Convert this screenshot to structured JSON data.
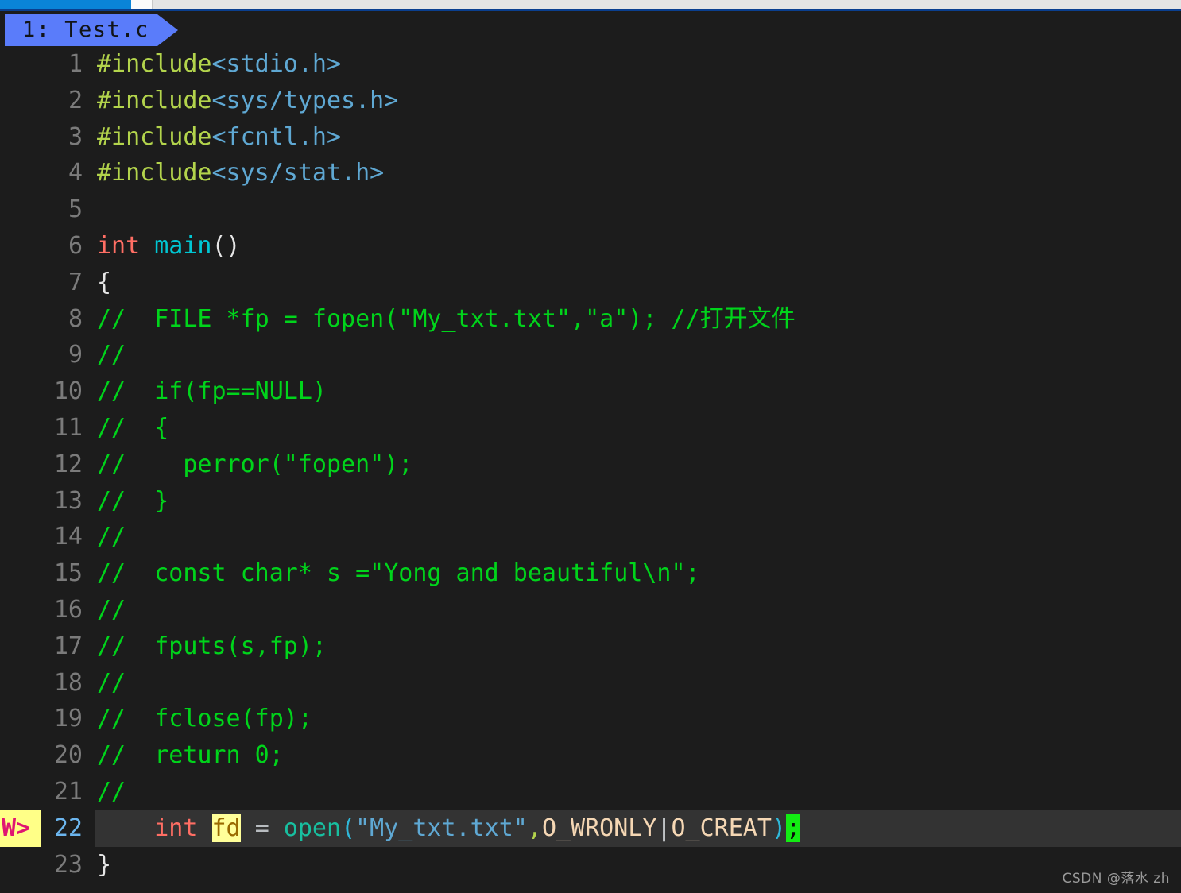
{
  "window": {
    "os_bar": {
      "active_segment_label": "",
      "accent_color": "#0a84d8",
      "underline_color": "#0a3f8f"
    }
  },
  "editor": {
    "app": "vim",
    "background_color": "#1c1c1c",
    "tabline": {
      "tabs": [
        {
          "label": "1: Test.c",
          "active": true,
          "bg_color": "#5a7cfa",
          "fg_color": "#111418"
        }
      ]
    },
    "cursor": {
      "line": 22,
      "character": ";",
      "color": "#13ec13"
    },
    "gutter_sign": {
      "line": 22,
      "text": "W>",
      "fg_color": "#e01572",
      "bg_color": "#ffff87"
    },
    "highlighted_identifier": {
      "text": "fd",
      "bg_color": "#ffff99",
      "fg_color": "#9a6a00"
    },
    "lines": [
      {
        "num": "1",
        "tokens": [
          {
            "t": "#include",
            "c": "s-pre"
          },
          {
            "t": "<stdio.h>",
            "c": "s-hdr"
          }
        ]
      },
      {
        "num": "2",
        "tokens": [
          {
            "t": "#include",
            "c": "s-pre"
          },
          {
            "t": "<sys/types.h>",
            "c": "s-hdr"
          }
        ]
      },
      {
        "num": "3",
        "tokens": [
          {
            "t": "#include",
            "c": "s-pre"
          },
          {
            "t": "<fcntl.h>",
            "c": "s-hdr"
          }
        ]
      },
      {
        "num": "4",
        "tokens": [
          {
            "t": "#include",
            "c": "s-pre"
          },
          {
            "t": "<sys/stat.h>",
            "c": "s-hdr"
          }
        ]
      },
      {
        "num": "5",
        "tokens": []
      },
      {
        "num": "6",
        "tokens": [
          {
            "t": "int",
            "c": "s-type"
          },
          {
            "t": " ",
            "c": "s-punct"
          },
          {
            "t": "main",
            "c": "s-func"
          },
          {
            "t": "()",
            "c": "s-punct"
          }
        ]
      },
      {
        "num": "7",
        "tokens": [
          {
            "t": "{",
            "c": "s-punct"
          }
        ]
      },
      {
        "num": "8",
        "tokens": [
          {
            "t": "//  FILE *fp = fopen(\"My_txt.txt\",\"a\"); //打开文件",
            "c": "s-comment"
          }
        ]
      },
      {
        "num": "9",
        "tokens": [
          {
            "t": "//",
            "c": "s-comment"
          }
        ]
      },
      {
        "num": "10",
        "tokens": [
          {
            "t": "//  if(fp==NULL)",
            "c": "s-comment"
          }
        ]
      },
      {
        "num": "11",
        "tokens": [
          {
            "t": "//  {",
            "c": "s-comment"
          }
        ]
      },
      {
        "num": "12",
        "tokens": [
          {
            "t": "//    perror(\"fopen\");",
            "c": "s-comment"
          }
        ]
      },
      {
        "num": "13",
        "tokens": [
          {
            "t": "//  }",
            "c": "s-comment"
          }
        ]
      },
      {
        "num": "14",
        "tokens": [
          {
            "t": "//",
            "c": "s-comment"
          }
        ]
      },
      {
        "num": "15",
        "tokens": [
          {
            "t": "//  const char* s =\"Yong and beautiful\\n\";",
            "c": "s-comment"
          }
        ]
      },
      {
        "num": "16",
        "tokens": [
          {
            "t": "//",
            "c": "s-comment"
          }
        ]
      },
      {
        "num": "17",
        "tokens": [
          {
            "t": "//  fputs(s,fp);",
            "c": "s-comment"
          }
        ]
      },
      {
        "num": "18",
        "tokens": [
          {
            "t": "//",
            "c": "s-comment"
          }
        ]
      },
      {
        "num": "19",
        "tokens": [
          {
            "t": "//  fclose(fp);",
            "c": "s-comment"
          }
        ]
      },
      {
        "num": "20",
        "tokens": [
          {
            "t": "//  return 0;",
            "c": "s-comment"
          }
        ]
      },
      {
        "num": "21",
        "tokens": [
          {
            "t": "//",
            "c": "s-comment"
          }
        ]
      },
      {
        "num": "22",
        "sign": "W>",
        "current": true,
        "tokens": [
          {
            "t": "    ",
            "c": "s-punct"
          },
          {
            "t": "int",
            "c": "s-type"
          },
          {
            "t": " ",
            "c": "s-punct"
          },
          {
            "t": "fd",
            "c": "s-ident-hl"
          },
          {
            "t": " ",
            "c": "s-punct"
          },
          {
            "t": "=",
            "c": "s-op"
          },
          {
            "t": " ",
            "c": "s-punct"
          },
          {
            "t": "open",
            "c": "s-call"
          },
          {
            "t": "(",
            "c": "s-paren"
          },
          {
            "t": "\"My_txt.txt\"",
            "c": "s-str"
          },
          {
            "t": ",",
            "c": "s-comma"
          },
          {
            "t": "O_WRONLY",
            "c": "s-const"
          },
          {
            "t": "|",
            "c": "s-pipe"
          },
          {
            "t": "O_CREAT",
            "c": "s-const"
          },
          {
            "t": ")",
            "c": "s-paren"
          },
          {
            "t": ";",
            "c": "s-cursor"
          }
        ]
      },
      {
        "num": "23",
        "tokens": [
          {
            "t": "}",
            "c": "s-brace-match"
          }
        ]
      }
    ]
  },
  "watermark": {
    "text": "CSDN @落水 zh"
  }
}
